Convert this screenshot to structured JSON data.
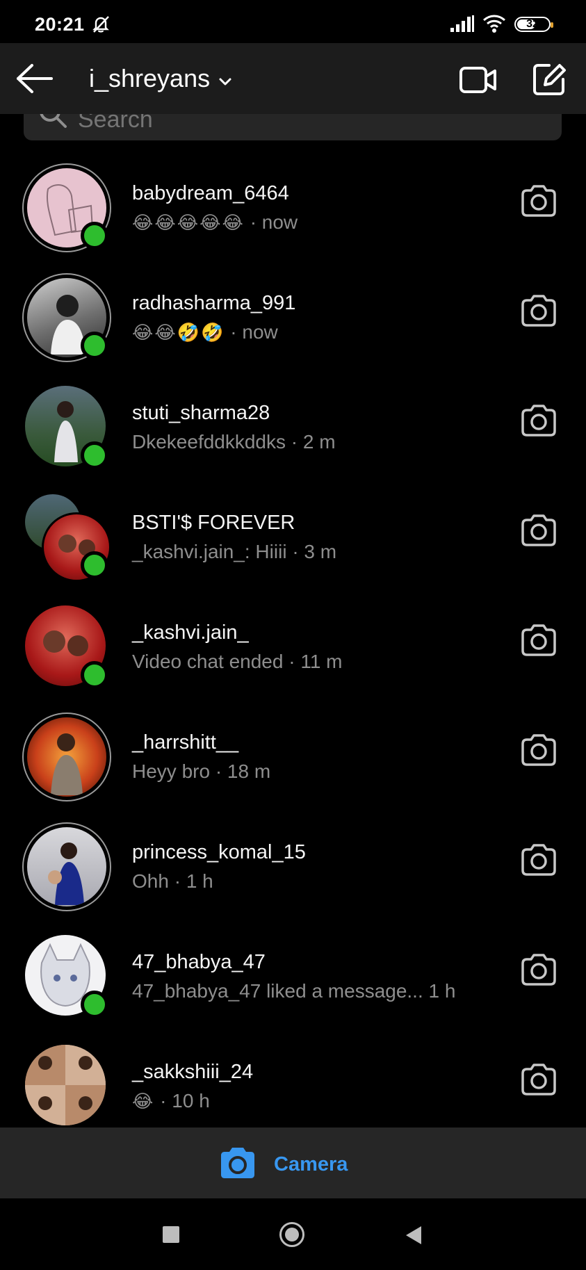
{
  "status_bar": {
    "time": "20:21",
    "battery": "32"
  },
  "header": {
    "account_name": "i_shreyans"
  },
  "search": {
    "placeholder": "Search"
  },
  "threads": [
    {
      "name": "babydream_6464",
      "preview": "😂😂😂😂😂",
      "time": "· now",
      "online": true
    },
    {
      "name": "radhasharma_991",
      "preview": "😂😂🤣🤣",
      "time": "· now",
      "online": true
    },
    {
      "name": "stuti_sharma28",
      "preview": "Dkekeefddkkddks",
      "time": "· 2 m",
      "online": true
    },
    {
      "name": "BSTI'$ FOREVER",
      "preview": "_kashvi.jain_: Hiiii",
      "time": "· 3 m",
      "online": true
    },
    {
      "name": "_kashvi.jain_",
      "preview": "Video chat ended",
      "time": "· 11 m",
      "online": true
    },
    {
      "name": "_harrshitt__",
      "preview": "Heyy bro",
      "time": "· 18 m",
      "online": false
    },
    {
      "name": "princess_komal_15",
      "preview": "Ohh",
      "time": "· 1 h",
      "online": false
    },
    {
      "name": "47_bhabya_47",
      "preview": "47_bhabya_47 liked a message...",
      "time": "1 h",
      "online": true
    },
    {
      "name": "_sakkshiii_24",
      "preview": "😂",
      "time": "· 10 h",
      "online": false
    }
  ],
  "bottom_bar": {
    "camera_label": "Camera"
  },
  "colors": {
    "accent": "#3897f0",
    "online": "#2ebd2e",
    "background": "#000000",
    "secondary_text": "#8e8e8e"
  },
  "icons": [
    "back-arrow-icon",
    "chevron-down-icon",
    "video-call-icon",
    "new-message-icon",
    "search-icon",
    "camera-icon"
  ]
}
